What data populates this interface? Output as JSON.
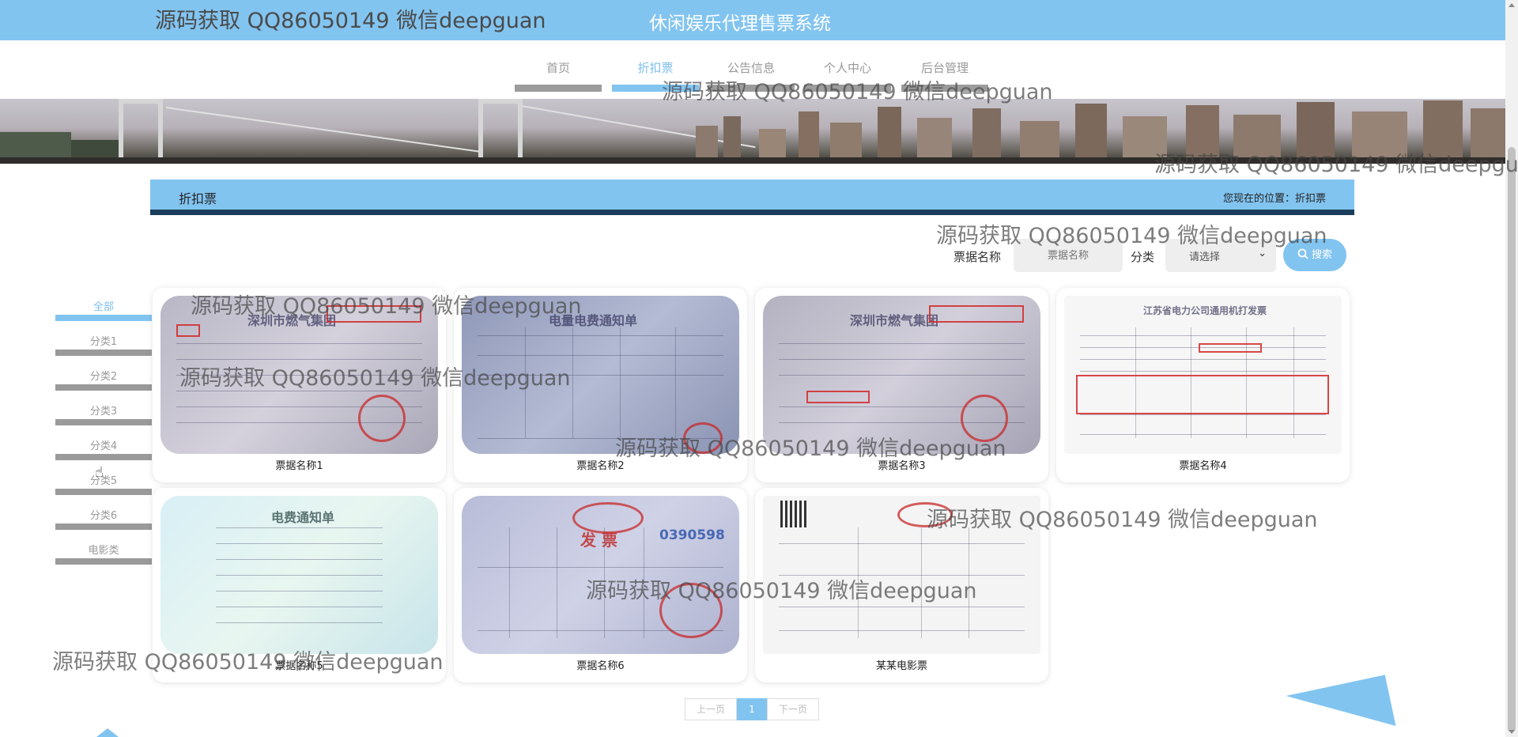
{
  "header": {
    "title": "休闲娱乐代理售票系统"
  },
  "nav": {
    "items": [
      {
        "label": "首页"
      },
      {
        "label": "折扣票"
      },
      {
        "label": "公告信息"
      },
      {
        "label": "个人中心"
      },
      {
        "label": "后台管理"
      }
    ],
    "active_index": 1
  },
  "section": {
    "title": "折扣票",
    "breadcrumb": "您现在的位置：折扣票"
  },
  "search": {
    "name_label": "票据名称",
    "name_placeholder": "票据名称",
    "category_label": "分类",
    "category_value": "请选择",
    "button_label": "搜索"
  },
  "categories": [
    {
      "label": "全部"
    },
    {
      "label": "分类1"
    },
    {
      "label": "分类2"
    },
    {
      "label": "分类3"
    },
    {
      "label": "分类4"
    },
    {
      "label": "分类5"
    },
    {
      "label": "分类6"
    },
    {
      "label": "电影类"
    }
  ],
  "cards": [
    {
      "name": "票据名称1"
    },
    {
      "name": "票据名称2"
    },
    {
      "name": "票据名称3"
    },
    {
      "name": "票据名称4"
    },
    {
      "name": "票据名称5"
    },
    {
      "name": "票据名称6"
    },
    {
      "name": "某某电影票"
    }
  ],
  "pagination": {
    "prev": "上一页",
    "current": "1",
    "next": "下一页"
  },
  "watermark": {
    "text": "源码获取 QQ86050149 微信deepguan"
  },
  "colors": {
    "primary": "#82c4f0",
    "dark_accent": "#1b3d5c",
    "muted_bar": "#9a9a9a"
  }
}
